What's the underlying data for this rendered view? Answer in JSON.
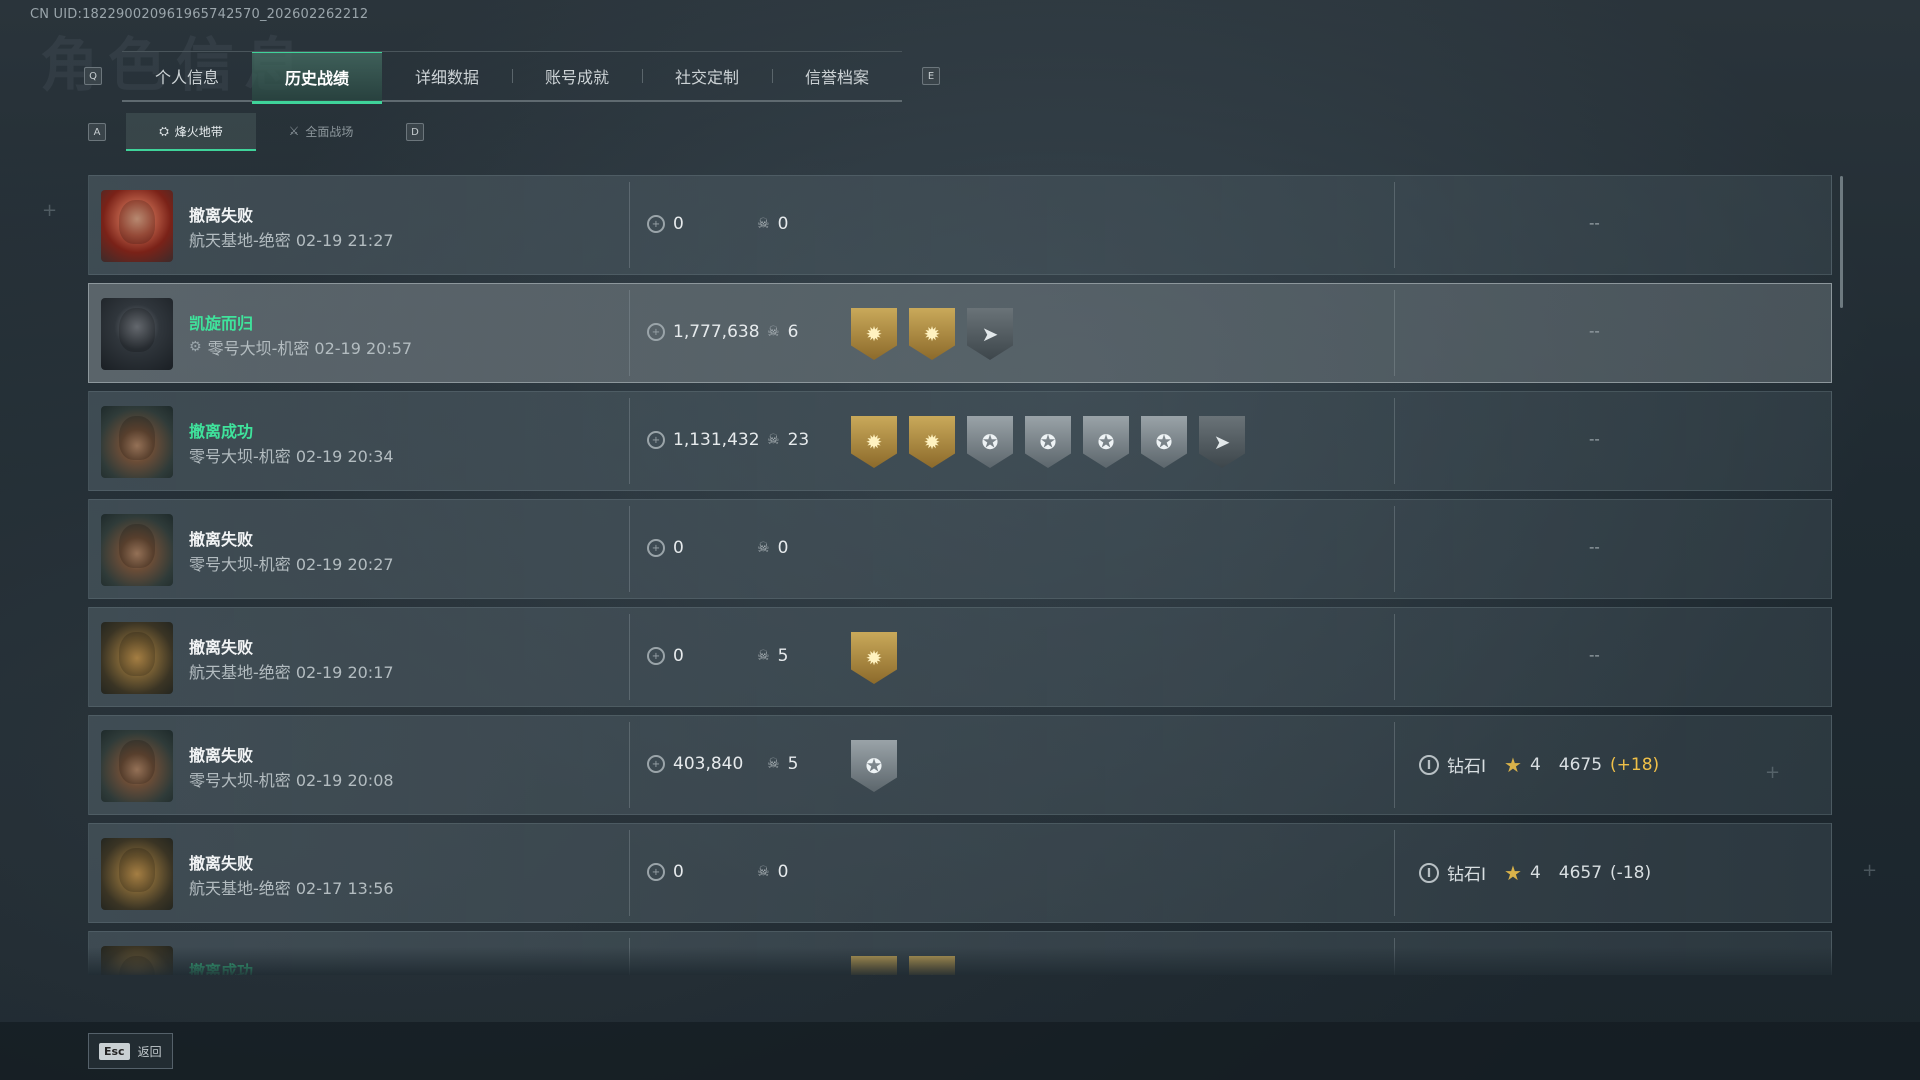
{
  "uid": "CN UID:1822900209619657425​70_202602262212",
  "watermark": "角色信息",
  "keys": {
    "left_tab": "Q",
    "right_tab": "E",
    "left_sub": "A",
    "right_sub": "D"
  },
  "tabs": [
    {
      "label": "个人信息",
      "active": false
    },
    {
      "label": "历史战绩",
      "active": true
    },
    {
      "label": "详细数据",
      "active": false
    },
    {
      "label": "账号成就",
      "active": false
    },
    {
      "label": "社交定制",
      "active": false
    },
    {
      "label": "信誉档案",
      "active": false
    }
  ],
  "subtabs": [
    {
      "label": "烽火地带",
      "icon": "zone-icon",
      "active": true
    },
    {
      "label": "全面战场",
      "icon": "battlefield-icon",
      "active": false
    }
  ],
  "matches": [
    {
      "avatar": "red",
      "status": "撤离失败",
      "success": false,
      "map": "航天基地-绝密 02-19 21:27",
      "map_icon": false,
      "money": "0",
      "kills": "0",
      "badges": [],
      "rank": null,
      "dash": "--",
      "highlight": false
    },
    {
      "avatar": "helmet-black",
      "status": "凯旋而归",
      "success": true,
      "map": "零号大坝-机密 02-19 20:57",
      "map_icon": true,
      "money": "1,777,638",
      "kills": "6",
      "badges": [
        "gold",
        "gold",
        "dark"
      ],
      "rank": null,
      "dash": "--",
      "highlight": true
    },
    {
      "avatar": "cap",
      "status": "撤离成功",
      "success": true,
      "map": "零号大坝-机密 02-19 20:34",
      "map_icon": false,
      "money": "1,131,432",
      "kills": "23",
      "badges": [
        "gold",
        "gold",
        "silver",
        "silver",
        "silver",
        "silver",
        "dark"
      ],
      "rank": null,
      "dash": "--",
      "highlight": false
    },
    {
      "avatar": "cap",
      "status": "撤离失败",
      "success": false,
      "map": "零号大坝-机密 02-19 20:27",
      "map_icon": false,
      "money": "0",
      "kills": "0",
      "badges": [],
      "rank": null,
      "dash": "--",
      "highlight": false
    },
    {
      "avatar": "spiky",
      "status": "撤离失败",
      "success": false,
      "map": "航天基地-绝密 02-19 20:17",
      "map_icon": false,
      "money": "0",
      "kills": "5",
      "badges": [
        "gold"
      ],
      "rank": null,
      "dash": "--",
      "highlight": false
    },
    {
      "avatar": "cap",
      "status": "撤离失败",
      "success": false,
      "map": "零号大坝-机密 02-19 20:08",
      "map_icon": false,
      "money": "403,840",
      "kills": "5",
      "badges": [
        "silver"
      ],
      "rank": {
        "tier": "钻石Ⅰ",
        "stars": "4",
        "score": "4675",
        "delta": "(+18)",
        "up": true
      },
      "dash": null,
      "highlight": false
    },
    {
      "avatar": "spiky",
      "status": "撤离失败",
      "success": false,
      "map": "航天基地-绝密 02-17 13:56",
      "map_icon": false,
      "money": "0",
      "kills": "0",
      "badges": [],
      "rank": {
        "tier": "钻石Ⅰ",
        "stars": "4",
        "score": "4657",
        "delta": "(-18)",
        "up": false
      },
      "dash": null,
      "highlight": false
    },
    {
      "avatar": "spiky",
      "status": "撤离成功",
      "success": true,
      "map": "",
      "map_icon": false,
      "money": "",
      "kills": "",
      "badges": [
        "gold",
        "gold"
      ],
      "rank": null,
      "dash": null,
      "highlight": false
    }
  ],
  "footer": {
    "key": "Esc",
    "label": "返回"
  }
}
